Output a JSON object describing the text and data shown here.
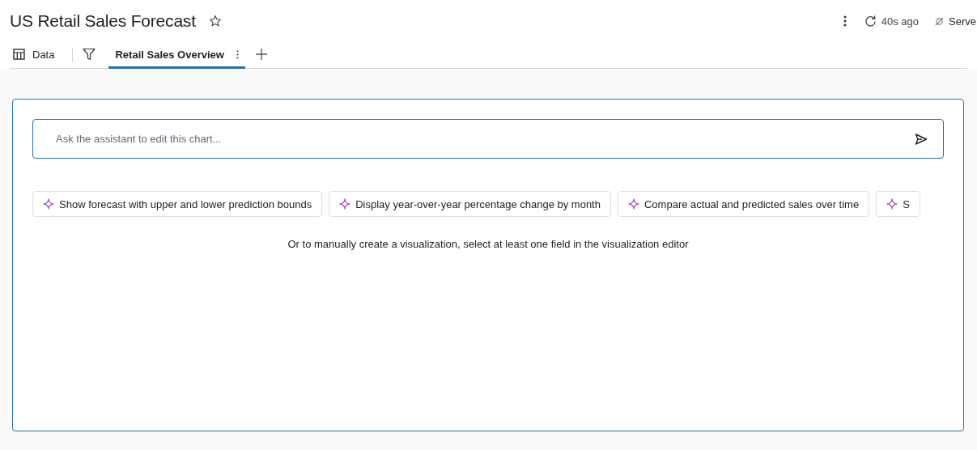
{
  "title": "US Retail Sales Forecast",
  "favorite": false,
  "header_actions": {
    "refresh_label": "40s ago",
    "server_label": "Serve"
  },
  "tabs": [
    {
      "kind": "data",
      "label": "Data",
      "selected": false
    },
    {
      "kind": "filter",
      "selected": false
    },
    {
      "kind": "page",
      "label": "Retail Sales Overview",
      "selected": true
    },
    {
      "kind": "add"
    }
  ],
  "assistant": {
    "placeholder": "Ask the assistant to edit this chart...",
    "suggestions": [
      "Show forecast with upper and lower prediction bounds",
      "Display year-over-year percentage change by month",
      "Compare actual and predicted sales over time",
      "S"
    ],
    "hint": "Or to manually create a visualization, select at least one field in the visualization editor"
  }
}
